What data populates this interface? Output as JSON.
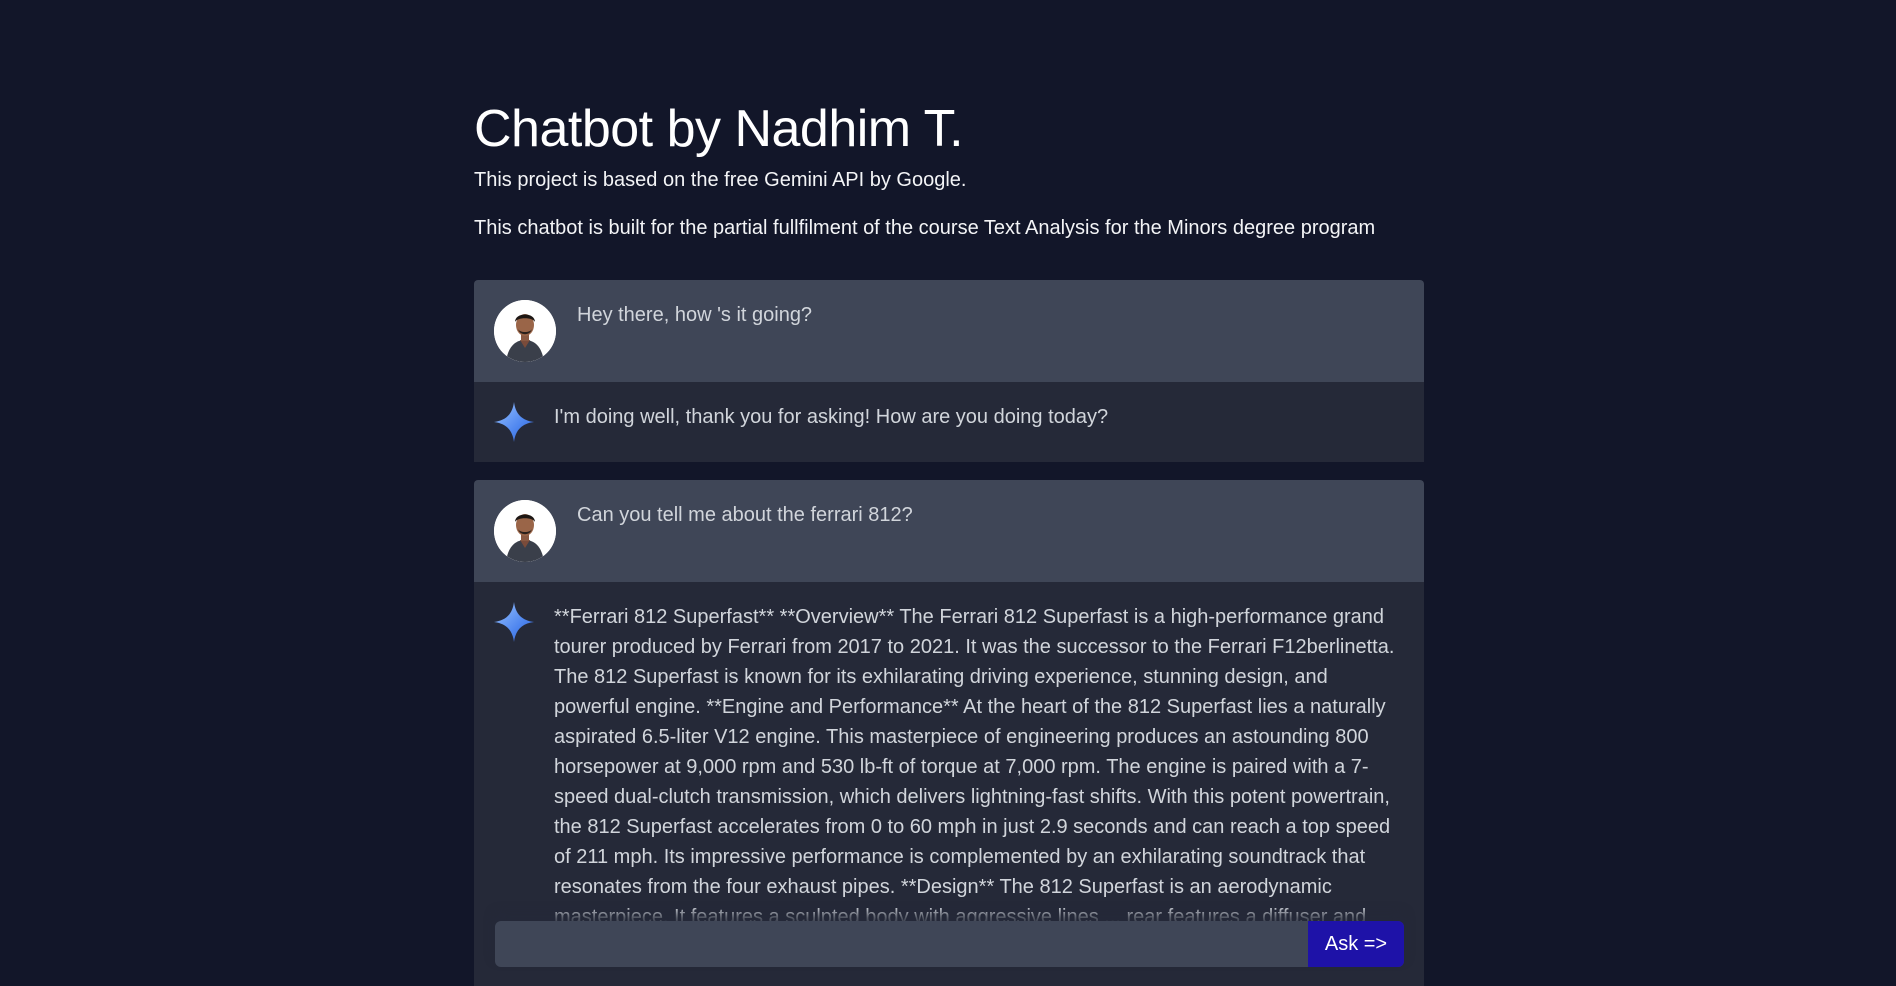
{
  "header": {
    "title": "Chatbot by Nadhim T.",
    "subtitle": "This project is based on the free Gemini API by Google.",
    "description": "This chatbot is built for the partial fullfilment of the course Text Analysis for the Minors degree program"
  },
  "messages": [
    {
      "role": "user",
      "text": "Hey there, how 's it going?"
    },
    {
      "role": "bot",
      "text": "I'm doing well, thank you for asking! How are you doing today?"
    },
    {
      "role": "user",
      "text": "Can you tell me about the ferrari 812?"
    },
    {
      "role": "bot",
      "text": "**Ferrari 812 Superfast** **Overview** The Ferrari 812 Superfast is a high-performance grand tourer produced by Ferrari from 2017 to 2021. It was the successor to the Ferrari F12berlinetta. The 812 Superfast is known for its exhilarating driving experience, stunning design, and powerful engine. **Engine and Performance** At the heart of the 812 Superfast lies a naturally aspirated 6.5-liter V12 engine. This masterpiece of engineering produces an astounding 800 horsepower at 9,000 rpm and 530 lb-ft of torque at 7,000 rpm. The engine is paired with a 7-speed dual-clutch transmission, which delivers lightning-fast shifts. With this potent powertrain, the 812 Superfast accelerates from 0 to 60 mph in just 2.9 seconds and can reach a top speed of 211 mph. Its impressive performance is complemented by an exhilarating soundtrack that resonates from the four exhaust pipes. **Design** The 812 Superfast is an aerodynamic masterpiece. It features a sculpted body with aggressive lines ... rear features a diffuser and dual circular taillights. The interior is equally stunning, with a"
    }
  ],
  "input": {
    "value": "",
    "placeholder": ""
  },
  "ask_button": {
    "label": "Ask =>"
  },
  "colors": {
    "background": "#121629",
    "user_message_bg": "#3f4657",
    "bot_message_bg": "#252938",
    "ask_button": "#1e12a8"
  },
  "icons": {
    "user_avatar": "user-avatar",
    "bot_avatar": "gemini-sparkle-icon"
  }
}
